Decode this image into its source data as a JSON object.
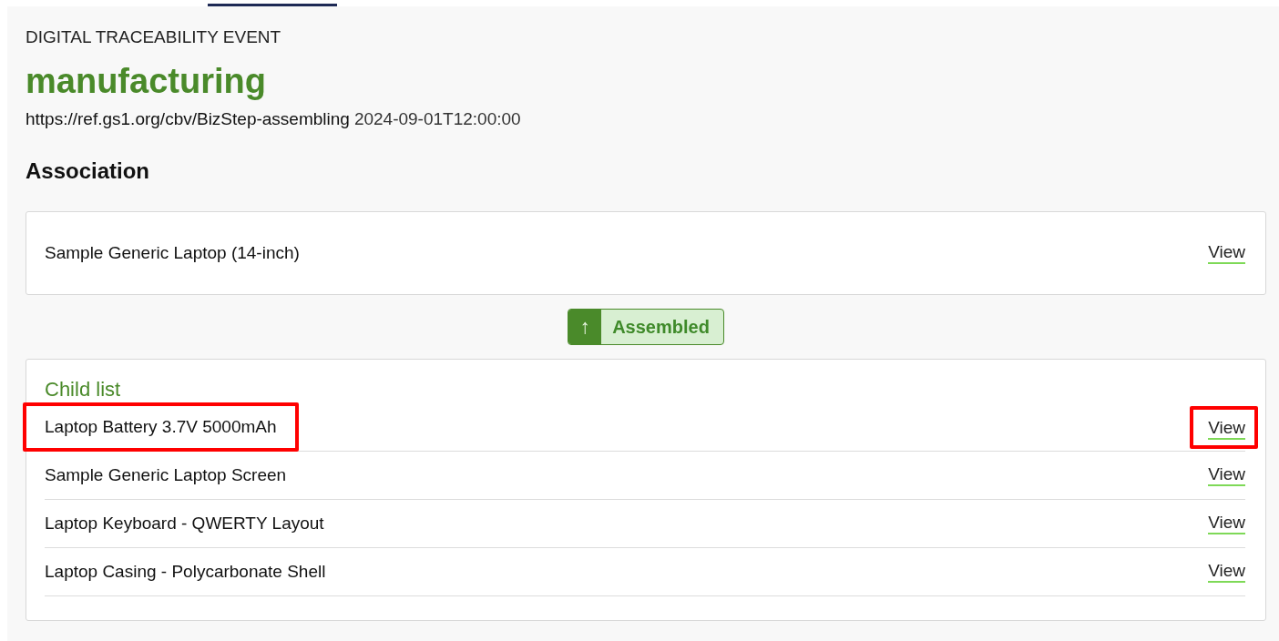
{
  "event_type": "DIGITAL TRACEABILITY EVENT",
  "title": "manufacturing",
  "biz_step": "https://ref.gs1.org/cbv/BizStep-assembling",
  "timestamp": "2024-09-01T12:00:00",
  "section_heading": "Association",
  "parent": {
    "name": "Sample Generic Laptop (14-inch)",
    "link": "View"
  },
  "action_badge": {
    "icon": "↑",
    "label": "Assembled"
  },
  "child_list": {
    "heading": "Child list",
    "items": [
      {
        "name": "Laptop Battery 3.7V 5000mAh",
        "link": "View",
        "highlighted": true
      },
      {
        "name": "Sample Generic Laptop Screen",
        "link": "View",
        "highlighted": false
      },
      {
        "name": "Laptop Keyboard - QWERTY Layout",
        "link": "View",
        "highlighted": false
      },
      {
        "name": "Laptop Casing - Polycarbonate Shell",
        "link": "View",
        "highlighted": false
      }
    ]
  }
}
